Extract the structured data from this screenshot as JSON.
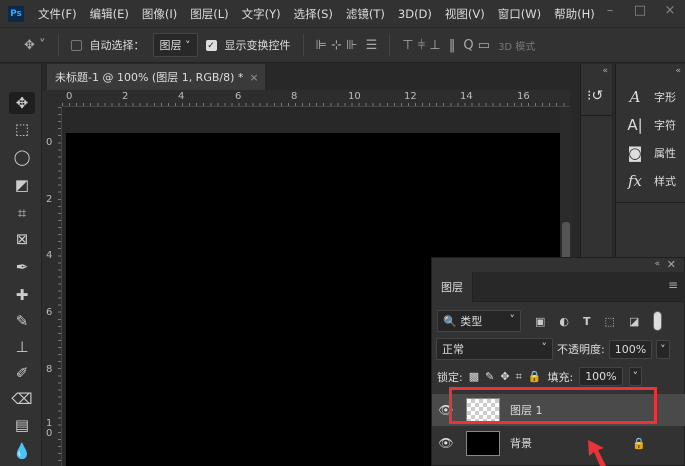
{
  "app": {
    "logo": "Ps",
    "menus": [
      "文件(F)",
      "编辑(E)",
      "图像(I)",
      "图层(L)",
      "文字(Y)",
      "选择(S)",
      "滤镜(T)",
      "3D(D)",
      "视图(V)",
      "窗口(W)",
      "帮助(H)"
    ],
    "window_controls": [
      "–",
      "□",
      "×"
    ]
  },
  "options": {
    "auto_select_label": "自动选择：",
    "auto_select_target": "图层",
    "show_transform_label": "显示变换控件",
    "mode_3d": "3D 模式"
  },
  "document": {
    "tab_title": "未标题-1 @ 100% (图层 1, RGB/8) *",
    "close": "×"
  },
  "rulers": {
    "h": [
      "0",
      "2",
      "4",
      "6",
      "8",
      "10",
      "12",
      "14",
      "16"
    ],
    "v": [
      "0",
      "2",
      "4",
      "6",
      "8",
      "1\n0"
    ]
  },
  "side_panels": [
    {
      "label": "字形",
      "icon": "glyphs-icon"
    },
    {
      "label": "字符",
      "icon": "character-icon"
    },
    {
      "label": "属性",
      "icon": "properties-icon"
    },
    {
      "label": "样式",
      "icon": "styles-icon"
    }
  ],
  "layers_panel": {
    "title": "图层",
    "filter": "类型",
    "blend_mode": "正常",
    "opacity_label": "不透明度:",
    "opacity": "100%",
    "lock_label": "锁定:",
    "fill_label": "填充:",
    "fill": "100%",
    "layers": [
      {
        "name": "图层 1",
        "selected": true
      },
      {
        "name": "背景",
        "locked": true
      }
    ]
  },
  "colors": {
    "highlight": "#e8333a",
    "accent": "#31a8ff"
  }
}
